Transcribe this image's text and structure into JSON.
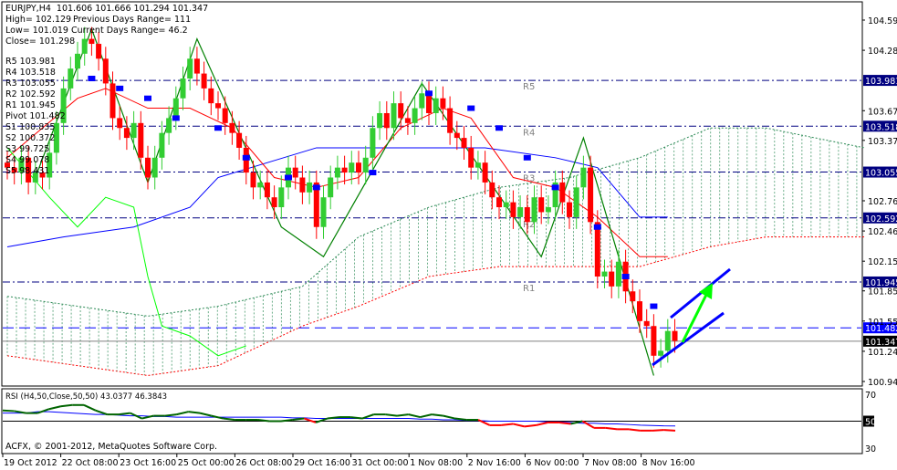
{
  "header": {
    "line1": "EURJPY,H4  101.606 101.666 101.294 101.347",
    "high": "High= 102.129",
    "prev_range": "Previous Days Range= 111",
    "low": "Low= 101.019",
    "cur_range": "Current Days Range= 46.2",
    "close": "Close= 101.298"
  },
  "pivot_list": [
    "R5 103.981",
    "R4 103.518",
    "R3 103.055",
    "R2 102.592",
    "R1 101.945",
    "Pivot 101.482",
    "S1 100.835",
    "S2 100.372",
    "S3 99.725",
    "S4 99.078",
    "S5 98.431"
  ],
  "copyright": "ACFX, © 2001-2012, MetaQuotes Software Corp.",
  "colors": {
    "bull": "#32cd32",
    "bear": "#ff0000",
    "pivot": "#000080",
    "pivot_main": "#0000ff",
    "cloud": "#2e8b57",
    "tenkan": "#ff0000",
    "kijun": "#0000ff",
    "chikou": "#00ff00",
    "zigzag": "#008000",
    "sar": "#0000ff",
    "rsi_up": "#006400",
    "rsi_down": "#ff0000",
    "rsi_ma": "#0000ff",
    "trend": "#0000ff",
    "arrow": "#00ff00"
  },
  "chart_data": [
    {
      "type": "candlestick",
      "title": "EURJPY,H4",
      "ylim": [
        100.94,
        104.59
      ],
      "y_ticks": [
        "104.590",
        "104.285",
        "103.675",
        "103.375",
        "102.765",
        "102.460",
        "102.155",
        "101.855",
        "101.550",
        "101.245",
        "100.940"
      ],
      "price_tags": [
        {
          "label": "103.981",
          "value": 103.981,
          "kind": "pivot",
          "name": "R5"
        },
        {
          "label": "103.518",
          "value": 103.518,
          "kind": "pivot",
          "name": "R4"
        },
        {
          "label": "103.055",
          "value": 103.055,
          "kind": "pivot",
          "name": "R3"
        },
        {
          "label": "102.592",
          "value": 102.592,
          "kind": "pivot",
          "name": "R2"
        },
        {
          "label": "101.945",
          "value": 101.945,
          "kind": "pivot",
          "name": "R1"
        },
        {
          "label": "101.482",
          "value": 101.482,
          "kind": "pivot-main",
          "name": ""
        },
        {
          "label": "101.347",
          "value": 101.347,
          "kind": "bid",
          "name": ""
        }
      ],
      "x_labels": [
        "19 Oct 2012",
        "22 Oct 08:00",
        "23 Oct 16:00",
        "25 Oct 00:00",
        "26 Oct 08:00",
        "29 Oct 16:00",
        "31 Oct 00:00",
        "1 Nov 08:00",
        "2 Nov 16:00",
        "6 Nov 00:00",
        "7 Nov 08:00",
        "8 Nov 16:00"
      ],
      "closes": [
        103.1,
        103.05,
        103.2,
        102.95,
        103.05,
        103.0,
        103.25,
        103.55,
        103.9,
        104.1,
        104.25,
        104.4,
        104.35,
        104.2,
        103.95,
        103.6,
        103.5,
        103.4,
        103.55,
        103.2,
        103.0,
        103.2,
        103.45,
        103.6,
        103.8,
        104.0,
        104.2,
        104.05,
        103.9,
        103.75,
        103.7,
        103.55,
        103.45,
        103.3,
        103.05,
        102.9,
        102.95,
        102.8,
        102.7,
        102.9,
        103.1,
        103.0,
        102.85,
        102.95,
        102.5,
        102.8,
        103.0,
        103.1,
        103.05,
        103.15,
        103.05,
        103.2,
        103.5,
        103.65,
        103.5,
        103.75,
        103.6,
        103.55,
        103.7,
        103.85,
        103.65,
        103.8,
        103.7,
        103.45,
        103.4,
        103.3,
        103.1,
        103.15,
        102.95,
        102.8,
        102.7,
        102.75,
        102.6,
        102.7,
        102.55,
        102.8,
        102.65,
        102.7,
        102.95,
        102.75,
        102.6,
        102.9,
        103.1,
        102.55,
        102.0,
        102.05,
        101.9,
        102.15,
        101.85,
        101.75,
        101.55,
        101.5,
        101.2,
        101.25,
        101.45,
        101.35
      ],
      "zigzag": [
        [
          4,
          103.0
        ],
        [
          12,
          104.5
        ],
        [
          20,
          102.95
        ],
        [
          27,
          104.4
        ],
        [
          39,
          102.5
        ],
        [
          45,
          102.2
        ],
        [
          59,
          103.95
        ],
        [
          76,
          102.2
        ],
        [
          82,
          103.4
        ],
        [
          92,
          101.0
        ]
      ],
      "tenkan": [
        [
          0,
          103.2
        ],
        [
          10,
          103.8
        ],
        [
          14,
          103.9
        ],
        [
          20,
          103.7
        ],
        [
          26,
          103.7
        ],
        [
          32,
          103.5
        ],
        [
          38,
          103.0
        ],
        [
          44,
          102.9
        ],
        [
          50,
          103.0
        ],
        [
          56,
          103.5
        ],
        [
          62,
          103.7
        ],
        [
          66,
          103.6
        ],
        [
          72,
          103.0
        ],
        [
          78,
          102.9
        ],
        [
          84,
          102.6
        ],
        [
          90,
          102.2
        ],
        [
          94,
          102.2
        ]
      ],
      "kijun": [
        [
          0,
          102.3
        ],
        [
          8,
          102.4
        ],
        [
          18,
          102.5
        ],
        [
          26,
          102.7
        ],
        [
          30,
          103.0
        ],
        [
          44,
          103.3
        ],
        [
          60,
          103.3
        ],
        [
          68,
          103.3
        ],
        [
          78,
          103.2
        ],
        [
          84,
          103.1
        ],
        [
          90,
          102.6
        ],
        [
          94,
          102.6
        ]
      ],
      "chikou": [
        [
          0,
          103.3
        ],
        [
          6,
          102.8
        ],
        [
          10,
          102.5
        ],
        [
          14,
          102.8
        ],
        [
          18,
          102.7
        ],
        [
          20,
          102.0
        ],
        [
          22,
          101.5
        ],
        [
          26,
          101.4
        ],
        [
          30,
          101.2
        ],
        [
          34,
          101.3
        ]
      ],
      "sar": [
        [
          12,
          104.0
        ],
        [
          16,
          103.9
        ],
        [
          20,
          103.8
        ],
        [
          24,
          103.6
        ],
        [
          30,
          103.5
        ],
        [
          34,
          103.2
        ],
        [
          40,
          103.0
        ],
        [
          44,
          102.9
        ],
        [
          52,
          103.05
        ],
        [
          60,
          103.85
        ],
        [
          66,
          103.7
        ],
        [
          70,
          103.5
        ],
        [
          74,
          103.2
        ],
        [
          78,
          102.9
        ],
        [
          84,
          102.5
        ],
        [
          88,
          102.0
        ],
        [
          92,
          101.7
        ]
      ],
      "cloud_top": [
        [
          0,
          101.8
        ],
        [
          20,
          101.6
        ],
        [
          30,
          101.7
        ],
        [
          42,
          101.9
        ],
        [
          50,
          102.4
        ],
        [
          60,
          102.7
        ],
        [
          70,
          102.9
        ],
        [
          80,
          103.0
        ],
        [
          90,
          103.2
        ],
        [
          100,
          103.5
        ],
        [
          108,
          103.5
        ],
        [
          122,
          103.3
        ]
      ],
      "cloud_bottom": [
        [
          0,
          101.2
        ],
        [
          20,
          101.0
        ],
        [
          30,
          101.1
        ],
        [
          42,
          101.5
        ],
        [
          50,
          101.7
        ],
        [
          60,
          102.0
        ],
        [
          70,
          102.1
        ],
        [
          80,
          102.1
        ],
        [
          90,
          102.1
        ],
        [
          100,
          102.3
        ],
        [
          108,
          102.4
        ],
        [
          122,
          102.4
        ]
      ]
    },
    {
      "type": "line",
      "title": "RSI (H4,50,Close,50,50) 43.0377 46.3843",
      "ylim": [
        30,
        70
      ],
      "y_ticks": [
        "70",
        "50",
        "30"
      ],
      "rsi": [
        58,
        57.5,
        56,
        56,
        59,
        61,
        62,
        62,
        58,
        55,
        55,
        56,
        52,
        54,
        54,
        55,
        57,
        56,
        54,
        52,
        51,
        51,
        51,
        50,
        50,
        51,
        52,
        49,
        52,
        53,
        53,
        52,
        55,
        55,
        54,
        55,
        53,
        55,
        54,
        52,
        51,
        51,
        47,
        47,
        48,
        46,
        47,
        49,
        49,
        48,
        50,
        45,
        45,
        44,
        44,
        43,
        43,
        43.5,
        43
      ],
      "ma": [
        56,
        56,
        56,
        57,
        57,
        56.5,
        56,
        55.5,
        55,
        55,
        54.5,
        54,
        54,
        53.5,
        53.5,
        53,
        53,
        53,
        53,
        53,
        53,
        53,
        53,
        53,
        53,
        52.5,
        52.5,
        52,
        52,
        52,
        52,
        52,
        52,
        52,
        52,
        52,
        51.5,
        51.5,
        51,
        51,
        50.5,
        50.5,
        50,
        50,
        50,
        50,
        50,
        49.5,
        49.5,
        49,
        48.5,
        48.5,
        48,
        48,
        47.5,
        47,
        46.8,
        46.5,
        46.4
      ]
    }
  ]
}
